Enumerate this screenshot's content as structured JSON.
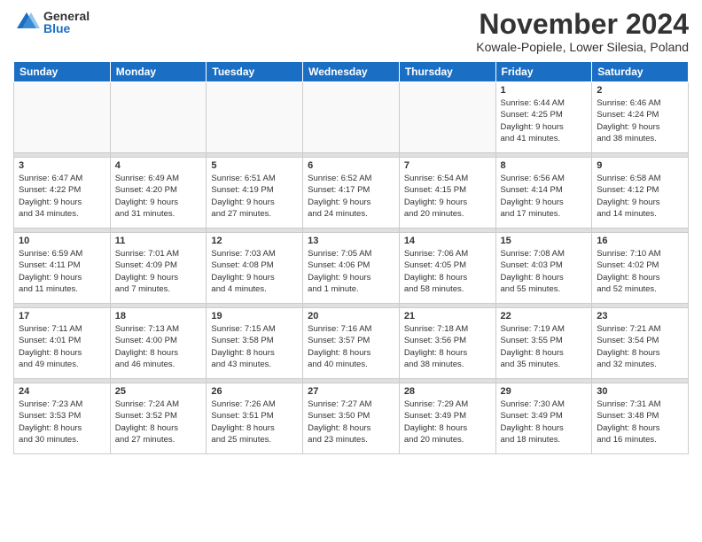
{
  "logo": {
    "general": "General",
    "blue": "Blue"
  },
  "title": "November 2024",
  "location": "Kowale-Popiele, Lower Silesia, Poland",
  "headers": [
    "Sunday",
    "Monday",
    "Tuesday",
    "Wednesday",
    "Thursday",
    "Friday",
    "Saturday"
  ],
  "weeks": [
    [
      {
        "day": "",
        "info": ""
      },
      {
        "day": "",
        "info": ""
      },
      {
        "day": "",
        "info": ""
      },
      {
        "day": "",
        "info": ""
      },
      {
        "day": "",
        "info": ""
      },
      {
        "day": "1",
        "info": "Sunrise: 6:44 AM\nSunset: 4:25 PM\nDaylight: 9 hours\nand 41 minutes."
      },
      {
        "day": "2",
        "info": "Sunrise: 6:46 AM\nSunset: 4:24 PM\nDaylight: 9 hours\nand 38 minutes."
      }
    ],
    [
      {
        "day": "3",
        "info": "Sunrise: 6:47 AM\nSunset: 4:22 PM\nDaylight: 9 hours\nand 34 minutes."
      },
      {
        "day": "4",
        "info": "Sunrise: 6:49 AM\nSunset: 4:20 PM\nDaylight: 9 hours\nand 31 minutes."
      },
      {
        "day": "5",
        "info": "Sunrise: 6:51 AM\nSunset: 4:19 PM\nDaylight: 9 hours\nand 27 minutes."
      },
      {
        "day": "6",
        "info": "Sunrise: 6:52 AM\nSunset: 4:17 PM\nDaylight: 9 hours\nand 24 minutes."
      },
      {
        "day": "7",
        "info": "Sunrise: 6:54 AM\nSunset: 4:15 PM\nDaylight: 9 hours\nand 20 minutes."
      },
      {
        "day": "8",
        "info": "Sunrise: 6:56 AM\nSunset: 4:14 PM\nDaylight: 9 hours\nand 17 minutes."
      },
      {
        "day": "9",
        "info": "Sunrise: 6:58 AM\nSunset: 4:12 PM\nDaylight: 9 hours\nand 14 minutes."
      }
    ],
    [
      {
        "day": "10",
        "info": "Sunrise: 6:59 AM\nSunset: 4:11 PM\nDaylight: 9 hours\nand 11 minutes."
      },
      {
        "day": "11",
        "info": "Sunrise: 7:01 AM\nSunset: 4:09 PM\nDaylight: 9 hours\nand 7 minutes."
      },
      {
        "day": "12",
        "info": "Sunrise: 7:03 AM\nSunset: 4:08 PM\nDaylight: 9 hours\nand 4 minutes."
      },
      {
        "day": "13",
        "info": "Sunrise: 7:05 AM\nSunset: 4:06 PM\nDaylight: 9 hours\nand 1 minute."
      },
      {
        "day": "14",
        "info": "Sunrise: 7:06 AM\nSunset: 4:05 PM\nDaylight: 8 hours\nand 58 minutes."
      },
      {
        "day": "15",
        "info": "Sunrise: 7:08 AM\nSunset: 4:03 PM\nDaylight: 8 hours\nand 55 minutes."
      },
      {
        "day": "16",
        "info": "Sunrise: 7:10 AM\nSunset: 4:02 PM\nDaylight: 8 hours\nand 52 minutes."
      }
    ],
    [
      {
        "day": "17",
        "info": "Sunrise: 7:11 AM\nSunset: 4:01 PM\nDaylight: 8 hours\nand 49 minutes."
      },
      {
        "day": "18",
        "info": "Sunrise: 7:13 AM\nSunset: 4:00 PM\nDaylight: 8 hours\nand 46 minutes."
      },
      {
        "day": "19",
        "info": "Sunrise: 7:15 AM\nSunset: 3:58 PM\nDaylight: 8 hours\nand 43 minutes."
      },
      {
        "day": "20",
        "info": "Sunrise: 7:16 AM\nSunset: 3:57 PM\nDaylight: 8 hours\nand 40 minutes."
      },
      {
        "day": "21",
        "info": "Sunrise: 7:18 AM\nSunset: 3:56 PM\nDaylight: 8 hours\nand 38 minutes."
      },
      {
        "day": "22",
        "info": "Sunrise: 7:19 AM\nSunset: 3:55 PM\nDaylight: 8 hours\nand 35 minutes."
      },
      {
        "day": "23",
        "info": "Sunrise: 7:21 AM\nSunset: 3:54 PM\nDaylight: 8 hours\nand 32 minutes."
      }
    ],
    [
      {
        "day": "24",
        "info": "Sunrise: 7:23 AM\nSunset: 3:53 PM\nDaylight: 8 hours\nand 30 minutes."
      },
      {
        "day": "25",
        "info": "Sunrise: 7:24 AM\nSunset: 3:52 PM\nDaylight: 8 hours\nand 27 minutes."
      },
      {
        "day": "26",
        "info": "Sunrise: 7:26 AM\nSunset: 3:51 PM\nDaylight: 8 hours\nand 25 minutes."
      },
      {
        "day": "27",
        "info": "Sunrise: 7:27 AM\nSunset: 3:50 PM\nDaylight: 8 hours\nand 23 minutes."
      },
      {
        "day": "28",
        "info": "Sunrise: 7:29 AM\nSunset: 3:49 PM\nDaylight: 8 hours\nand 20 minutes."
      },
      {
        "day": "29",
        "info": "Sunrise: 7:30 AM\nSunset: 3:49 PM\nDaylight: 8 hours\nand 18 minutes."
      },
      {
        "day": "30",
        "info": "Sunrise: 7:31 AM\nSunset: 3:48 PM\nDaylight: 8 hours\nand 16 minutes."
      }
    ]
  ]
}
